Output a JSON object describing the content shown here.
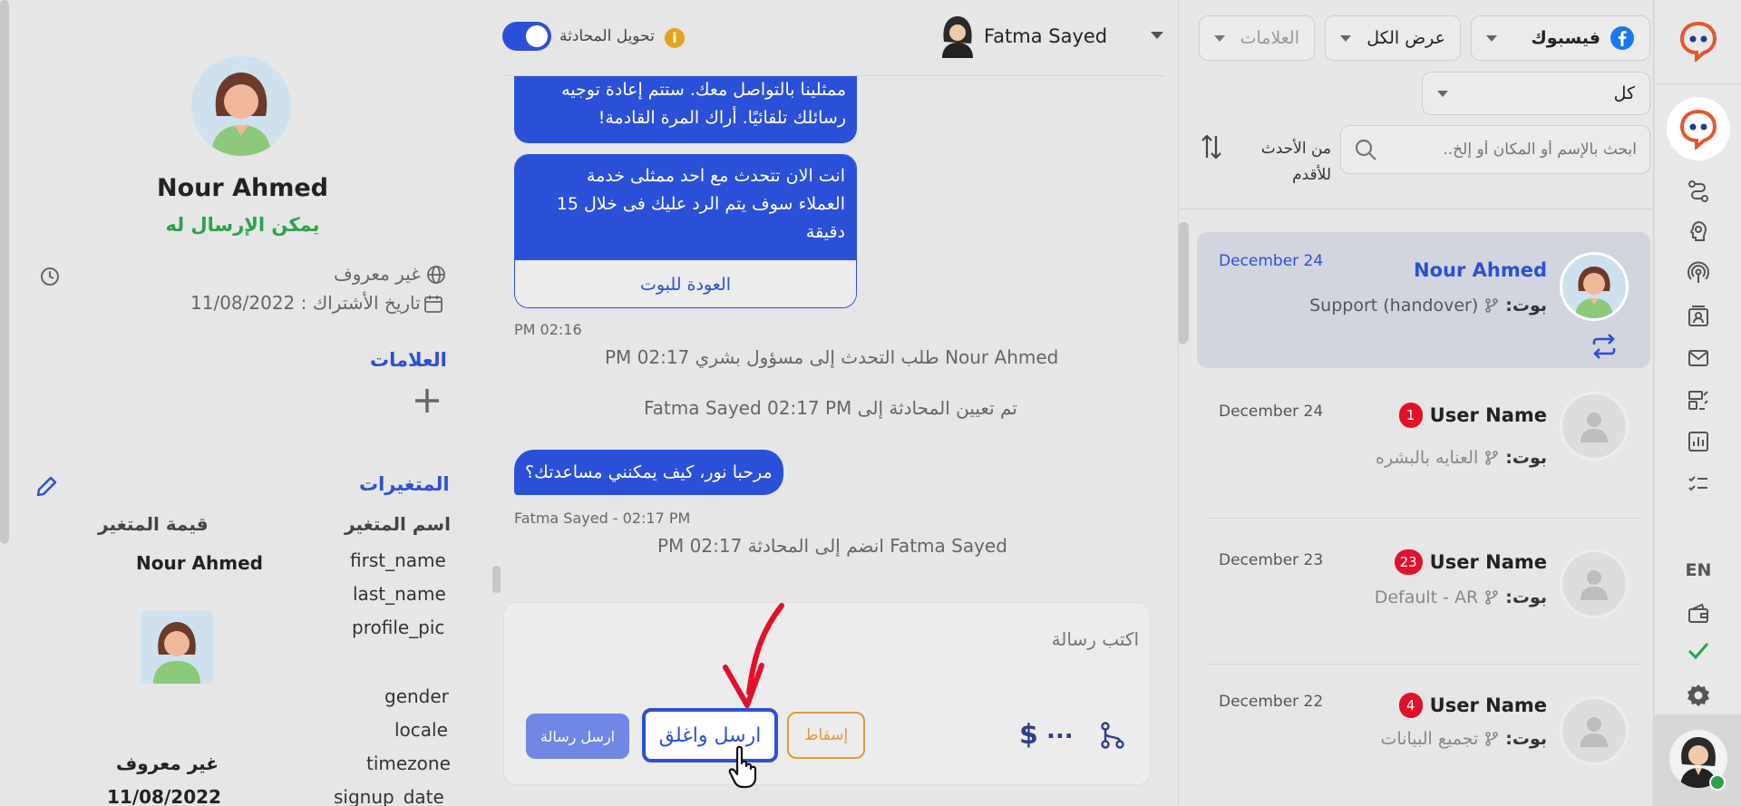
{
  "colors": {
    "accent": "#2b50d8",
    "success": "#2ca24e",
    "danger": "#e3102a",
    "drop": "#e09a3c",
    "brand": "#e3572d"
  },
  "rail": {
    "language": "EN",
    "icons": [
      "logo-icon",
      "active-logo-icon",
      "flow-icon",
      "brain-icon",
      "broadcast-icon",
      "contacts-icon",
      "mail-icon",
      "widgets-icon",
      "analytics-icon",
      "tasks-icon",
      "wallet-icon",
      "check-icon",
      "settings-icon",
      "agent-avatar"
    ]
  },
  "filters": {
    "channel": "فيسبوك",
    "view": "عرض الكل",
    "tags": "العلامات",
    "status": "كل",
    "search_placeholder": "ابحث بالإسم أو المكان أو إلخ..",
    "sort": "من الأحدث للأقدم"
  },
  "conversations": [
    {
      "name": "Nour Ahmed",
      "bot_label": "بوت:",
      "flow": "Support (handover)",
      "date": "December 24",
      "badge": "",
      "active": true
    },
    {
      "name": "User Name",
      "bot_label": "بوت:",
      "flow": "العنايه بالبشره",
      "date": "December 24",
      "badge": "1",
      "active": false
    },
    {
      "name": "User Name",
      "bot_label": "بوت:",
      "flow": "Default - AR",
      "date": "December 23",
      "badge": "23",
      "active": false
    },
    {
      "name": "User Name",
      "bot_label": "بوت:",
      "flow": "تجميع البيانات",
      "date": "December 22",
      "badge": "4",
      "active": false
    }
  ],
  "chat": {
    "agent_name": "Fatma Sayed",
    "transfer_label": "تحويل المحادثة",
    "transfer_on": true,
    "bubble1_line1": "ممثلينا بالتواصل معك. ستتم إعادة توجيه",
    "bubble1_line2": "رسائلك تلقائيًا. أراك المرة القادمة!",
    "bubble2_line1": "انت الان تتحدث مع احد ممثلى خدمة",
    "bubble2_line2": "العملاء سوف يتم الرد عليك فى خلال 15",
    "bubble2_line3": "دقيقة",
    "back_to_bot": "العودة للبوت",
    "time1": "PM 02:16",
    "sys1": "Nour Ahmed  طلب التحدث إلى مسؤول بشري PM 02:17",
    "sys2": "تم تعيين المحادثة إلى Fatma Sayed 02:17 PM",
    "agent_msg": "مرحبا نور، كيف يمكنني مساعدتك؟",
    "agent_meta": "Fatma Sayed - 02:17 PM",
    "sys3": "Fatma Sayed انضم إلى المحادثة PM 02:17",
    "composer_placeholder": "اكتب رسالة",
    "send_label": "ارسل رسالة",
    "send_close_label": "ارسل واغلق",
    "drop_label": "إسقاط",
    "more": "..."
  },
  "profile": {
    "name": "Nour Ahmed",
    "status": "يمكن الإرسال له",
    "location": "غير معروف",
    "subscription": "تاريخ الأشتراك : 11/08/2022",
    "tags_title": "العلامات",
    "variables_title": "المتغيرات",
    "var_name_header": "اسم المتغير",
    "var_value_header": "قيمة المتغير",
    "variables": [
      {
        "name": "first_name",
        "value": "Nour Ahmed"
      },
      {
        "name": "last_name",
        "value": ""
      },
      {
        "name": "profile_pic",
        "value": ""
      },
      {
        "name": "gender",
        "value": ""
      },
      {
        "name": "locale",
        "value": ""
      },
      {
        "name": "timezone",
        "value": "غير معروف"
      },
      {
        "name": "signup_date",
        "value": "11/08/2022"
      }
    ]
  }
}
